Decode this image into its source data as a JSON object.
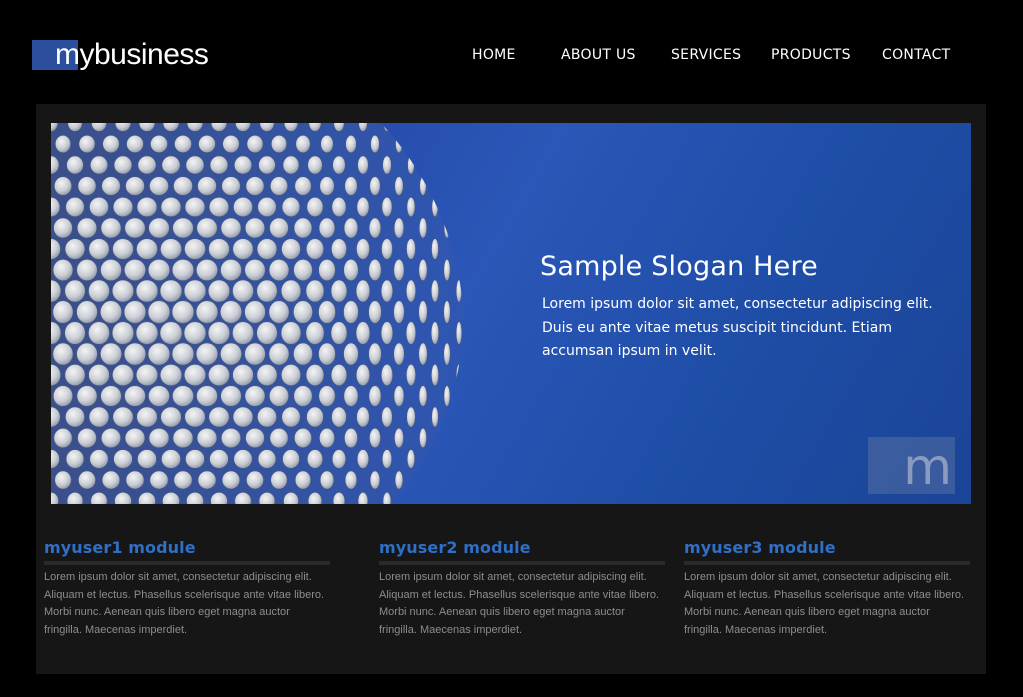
{
  "logo": {
    "text": "mybusiness",
    "accent_color": "#2b4f9c"
  },
  "nav": {
    "items": [
      {
        "label": "HOME"
      },
      {
        "label": "ABOUT US"
      },
      {
        "label": "SERVICES"
      },
      {
        "label": "PRODUCTS"
      },
      {
        "label": "CONTACT"
      }
    ]
  },
  "banner": {
    "title": "Sample Slogan Here",
    "text": "Lorem ipsum dolor sit amet, consectetur adipiscing elit. Duis eu ante vitae metus suscipit tincidunt. Etiam accumsan ipsum in velit.",
    "badge_letter": "m",
    "background_color": "#2b57b8"
  },
  "modules": [
    {
      "title": "myuser1 module",
      "text": "Lorem ipsum dolor sit amet, consectetur adipiscing elit. Aliquam et lectus. Phasellus scelerisque ante vitae libero. Morbi nunc. Aenean quis libero eget magna auctor fringilla. Maecenas imperdiet."
    },
    {
      "title": "myuser2 module",
      "text": "Lorem ipsum dolor sit amet, consectetur adipiscing elit. Aliquam et lectus. Phasellus scelerisque ante vitae libero. Morbi nunc. Aenean quis libero eget magna auctor fringilla. Maecenas imperdiet."
    },
    {
      "title": "myuser3 module",
      "text": "Lorem ipsum dolor sit amet, consectetur adipiscing elit. Aliquam et lectus. Phasellus scelerisque ante vitae libero. Morbi nunc. Aenean quis libero eget magna auctor fringilla. Maecenas imperdiet."
    }
  ],
  "colors": {
    "page_background": "#000000",
    "content_background": "#161616",
    "module_title": "#2f6fc7",
    "module_text": "#8d8d8d"
  }
}
